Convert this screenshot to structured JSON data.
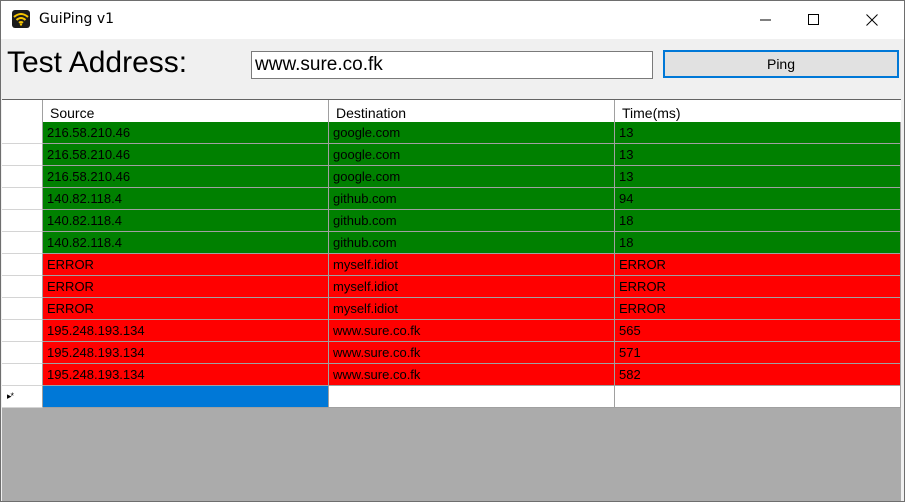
{
  "window": {
    "title": "GuiPing v1",
    "app_icon": "wifi-icon"
  },
  "form": {
    "label": "Test Address:",
    "address_value": "www.sure.co.fk",
    "ping_label": "Ping"
  },
  "grid": {
    "columns": [
      "Source",
      "Destination",
      "Time(ms)"
    ],
    "rows": [
      {
        "source": "216.58.210.46",
        "destination": "google.com",
        "time": "13",
        "status": "ok",
        "color": "#008000"
      },
      {
        "source": "216.58.210.46",
        "destination": "google.com",
        "time": "13",
        "status": "ok",
        "color": "#008000"
      },
      {
        "source": "216.58.210.46",
        "destination": "google.com",
        "time": "13",
        "status": "ok",
        "color": "#008000"
      },
      {
        "source": "140.82.118.4",
        "destination": "github.com",
        "time": "94",
        "status": "ok",
        "color": "#008000"
      },
      {
        "source": "140.82.118.4",
        "destination": "github.com",
        "time": "18",
        "status": "ok",
        "color": "#008000"
      },
      {
        "source": "140.82.118.4",
        "destination": "github.com",
        "time": "18",
        "status": "ok",
        "color": "#008000"
      },
      {
        "source": "ERROR",
        "destination": "myself.idiot",
        "time": "ERROR",
        "status": "error",
        "color": "#ff0000"
      },
      {
        "source": "ERROR",
        "destination": "myself.idiot",
        "time": "ERROR",
        "status": "error",
        "color": "#ff0000"
      },
      {
        "source": "ERROR",
        "destination": "myself.idiot",
        "time": "ERROR",
        "status": "error",
        "color": "#ff0000"
      },
      {
        "source": "195.248.193.134",
        "destination": "www.sure.co.fk",
        "time": "565",
        "status": "error",
        "color": "#ff0000"
      },
      {
        "source": "195.248.193.134",
        "destination": "www.sure.co.fk",
        "time": "571",
        "status": "error",
        "color": "#ff0000"
      },
      {
        "source": "195.248.193.134",
        "destination": "www.sure.co.fk",
        "time": "582",
        "status": "error",
        "color": "#ff0000"
      }
    ],
    "new_row_indicator": "new-row-icon"
  },
  "colors": {
    "ok": "#008000",
    "error": "#ff0000",
    "selection": "#0078d7",
    "button_border": "#0078d7"
  }
}
